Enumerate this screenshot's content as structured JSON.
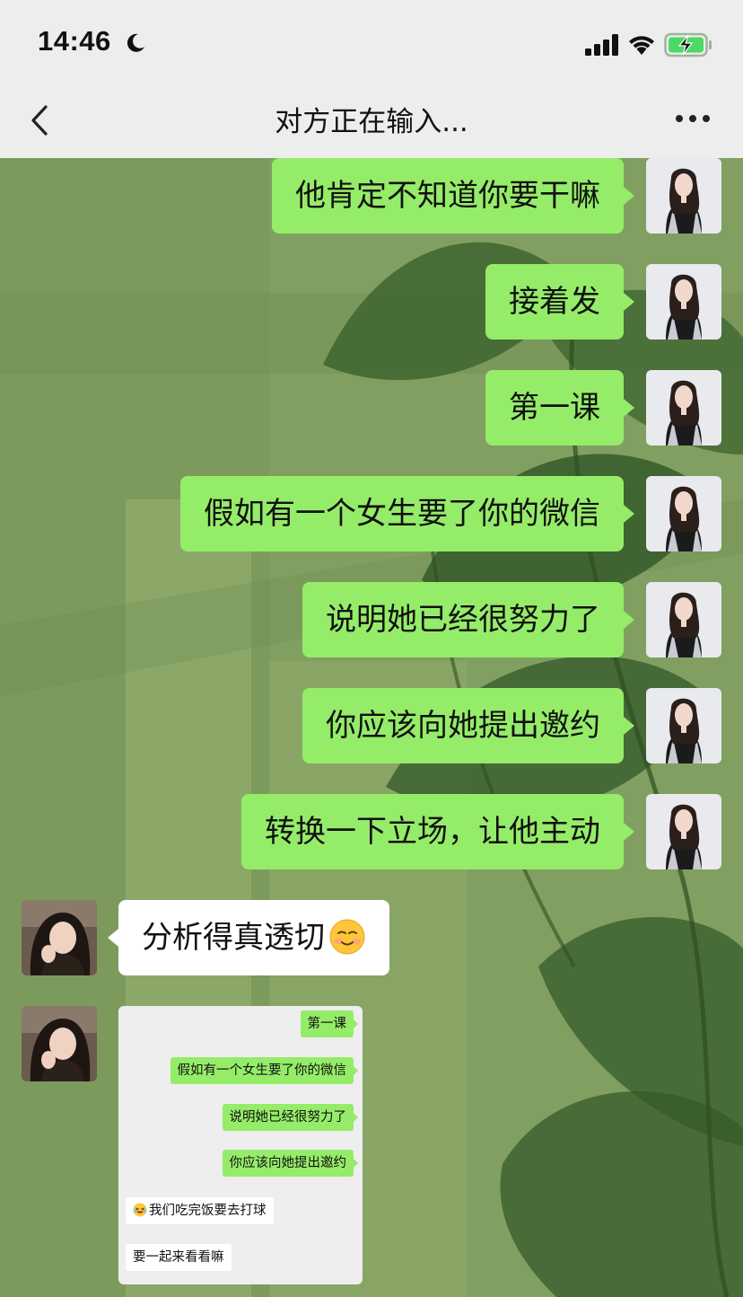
{
  "status_bar": {
    "time": "14:46",
    "icons": [
      "moon-icon",
      "signal-icon",
      "wifi-icon",
      "battery-charging-icon"
    ]
  },
  "header": {
    "title": "对方正在输入...",
    "back_icon": "chevron-left-icon",
    "more_icon": "more-icon"
  },
  "messages": [
    {
      "side": "out",
      "text": "他肯定不知道你要干嘛"
    },
    {
      "side": "out",
      "text": "接着发"
    },
    {
      "side": "out",
      "text": "第一课"
    },
    {
      "side": "out",
      "text": "假如有一个女生要了你的微信"
    },
    {
      "side": "out",
      "text": "说明她已经很努力了"
    },
    {
      "side": "out",
      "text": "你应该向她提出邀约"
    },
    {
      "side": "out",
      "text": "转换一下立场，让他主动"
    },
    {
      "side": "in",
      "text": "分析得真透切",
      "emoji": "smiling-face-icon"
    },
    {
      "side": "in",
      "type": "image"
    }
  ],
  "shared_screenshot": {
    "messages": [
      {
        "side": "out",
        "text": "第一课"
      },
      {
        "side": "out",
        "text": "假如有一个女生要了你的微信"
      },
      {
        "side": "out",
        "text": "说明她已经很努力了"
      },
      {
        "side": "out",
        "text": "你应该向她提出邀约"
      },
      {
        "side": "in",
        "text": "我们吃完饭要去打球",
        "emoji": "laughing-emoji-icon"
      },
      {
        "side": "in",
        "text": "要一起来看看嘛"
      }
    ]
  },
  "colors": {
    "outgoing_bubble": "#95ec69",
    "incoming_bubble": "#ffffff",
    "header_bg": "#ededed"
  }
}
